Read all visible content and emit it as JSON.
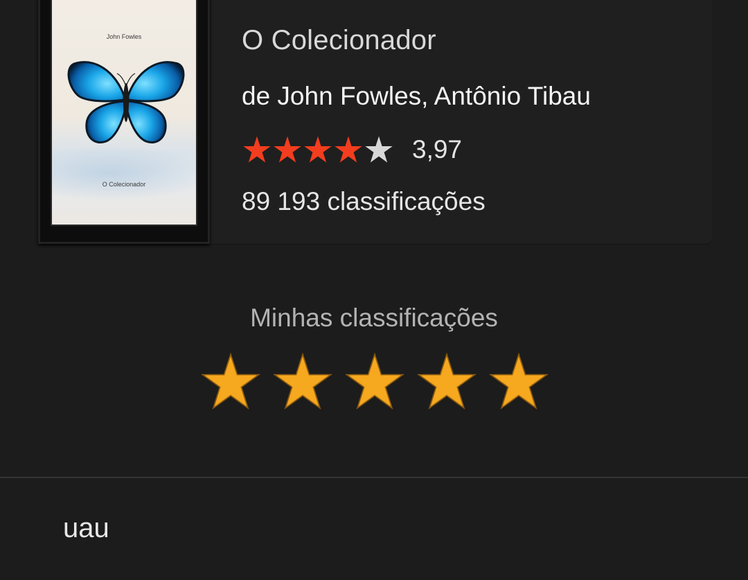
{
  "book": {
    "title": "O Colecionador",
    "authors": "de John Fowles, Antônio Tibau",
    "average_rating": "3,97",
    "average_rating_value": 3.97,
    "ratings_count": "89 193 classificações",
    "cover": {
      "author_text": "John Fowles",
      "title_text": "O Colecionador",
      "image": "blue-butterfly"
    },
    "rating_stars": {
      "filled": 4,
      "total": 5,
      "filled_color": "#f23d1e",
      "empty_color": "#d8d8d8"
    }
  },
  "my_rating": {
    "label": "Minhas classificações",
    "stars": 5,
    "total": 5,
    "color": "#f6a81e"
  },
  "review": {
    "text": "uau"
  }
}
